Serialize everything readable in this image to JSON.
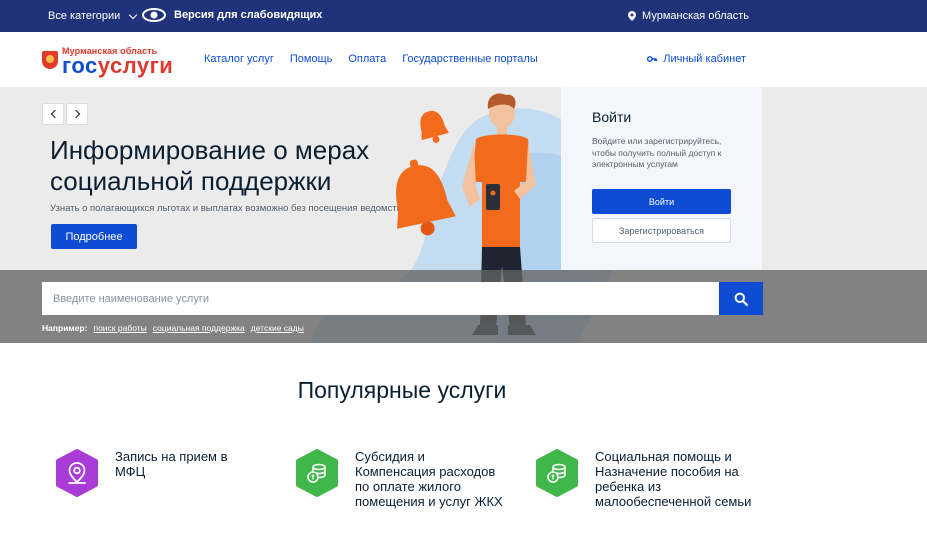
{
  "topbar": {
    "categories_label": "Все категории",
    "vision_label": "Версия для слабовидящих",
    "region_label": "Мурманская область"
  },
  "header": {
    "logo_region": "Мурманская область",
    "logo_gos": "гос",
    "logo_uslugi": "услуги",
    "nav": [
      "Каталог услуг",
      "Помощь",
      "Оплата",
      "Государственные порталы"
    ],
    "cabinet_label": "Личный кабинет"
  },
  "hero": {
    "title": "Информирование о мерах социальной поддержки",
    "subtitle": "Узнать о полагающихся льготах и выплатах возможно без посещения ведомств",
    "button_label": "Подробнее"
  },
  "login": {
    "title": "Войти",
    "description": "Войдите или зарегистрируйтесь, чтобы получить полный доступ к электронным услугам",
    "login_button": "Войти",
    "register_button": "Зарегистрироваться"
  },
  "search": {
    "placeholder": "Введите наименование услуги",
    "examples_label": "Например:",
    "examples": [
      "поиск работы",
      "социальная поддержка",
      "детские сады"
    ]
  },
  "popular": {
    "title": "Популярные услуги",
    "services": [
      {
        "label": "Запись на прием в МФЦ",
        "icon": "location-pin-icon",
        "color": "#a93bd6"
      },
      {
        "label": "Субсидия и Компенсация расходов по оплате жилого помещения и услуг ЖКХ",
        "icon": "coins-icon",
        "color": "#3fb74a"
      },
      {
        "label": "Социальная помощь и Назначение пособия на ребенка из малообеспеченной семьи",
        "icon": "coins-icon",
        "color": "#3fb74a"
      }
    ]
  },
  "colors": {
    "topbar": "#20327a",
    "accent": "#0d4cd3",
    "brand_red": "#e1392b",
    "bell": "#f26a1b"
  }
}
